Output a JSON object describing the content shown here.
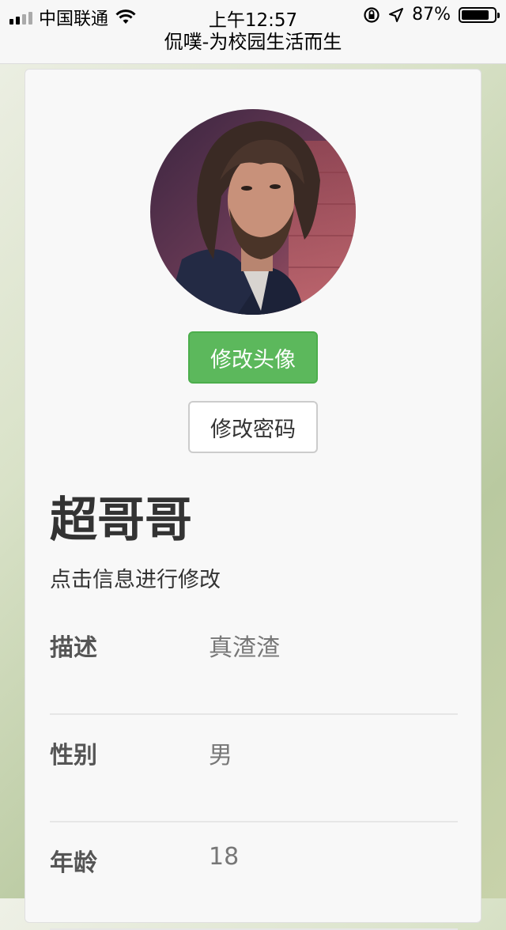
{
  "status_bar": {
    "carrier": "中国联通",
    "time": "上午12:57",
    "battery_text": "87%",
    "battery_level": 0.87,
    "signal_icon": "signal-bars-icon",
    "wifi_icon": "wifi-icon",
    "lock_icon": "rotation-lock-icon",
    "location_icon": "location-arrow-icon"
  },
  "nav": {
    "title": "侃噗-为校园生活而生"
  },
  "profile": {
    "avatar_icon": "user-avatar",
    "change_avatar_label": "修改头像",
    "change_password_label": "修改密码",
    "name": "超哥哥",
    "hint": "点击信息进行修改"
  },
  "info": [
    {
      "label": "描述",
      "value": "真渣渣"
    },
    {
      "label": "性别",
      "value": "男"
    },
    {
      "label": "年龄",
      "value": "18"
    }
  ],
  "colors": {
    "primary_button": "#5cb85c",
    "card_bg": "#f8f8f8"
  }
}
